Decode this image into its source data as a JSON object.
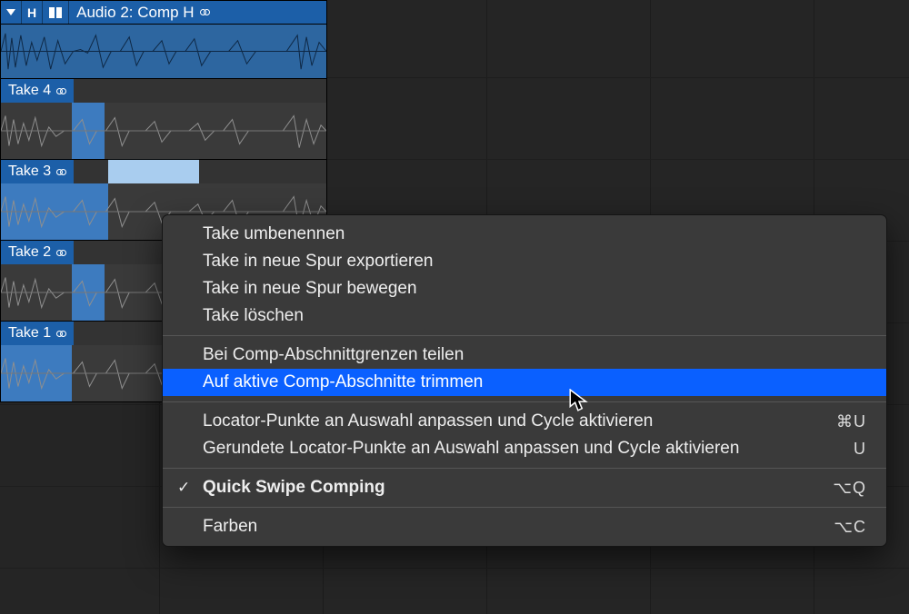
{
  "comp": {
    "header_letter": "H",
    "title": "Audio 2: Comp H"
  },
  "takes": [
    {
      "label": "Take 4",
      "sel_start": 78,
      "sel_width": 36
    },
    {
      "label": "Take 3",
      "sel_start": 0,
      "sel_width": 118,
      "light_start": 118,
      "light_width": 100
    },
    {
      "label": "Take 2",
      "sel_start": 78,
      "sel_width": 36
    },
    {
      "label": "Take 1",
      "sel_start": 0,
      "sel_width": 78
    }
  ],
  "menu": {
    "groups": [
      [
        {
          "label": "Take umbenennen"
        },
        {
          "label": "Take in neue Spur exportieren"
        },
        {
          "label": "Take in neue Spur bewegen"
        },
        {
          "label": "Take löschen"
        }
      ],
      [
        {
          "label": "Bei Comp-Abschnittgrenzen teilen"
        },
        {
          "label": "Auf aktive Comp-Abschnitte trimmen",
          "highlight": true
        }
      ],
      [
        {
          "label": "Locator-Punkte an Auswahl anpassen und Cycle aktivieren",
          "shortcut": "⌘U"
        },
        {
          "label": "Gerundete Locator-Punkte an Auswahl anpassen und Cycle aktivieren",
          "shortcut": "U"
        }
      ],
      [
        {
          "label": "Quick Swipe Comping",
          "shortcut": "⌥Q",
          "checked": true,
          "bold": true
        }
      ],
      [
        {
          "label": "Farben",
          "shortcut": "⌥C"
        }
      ]
    ]
  }
}
